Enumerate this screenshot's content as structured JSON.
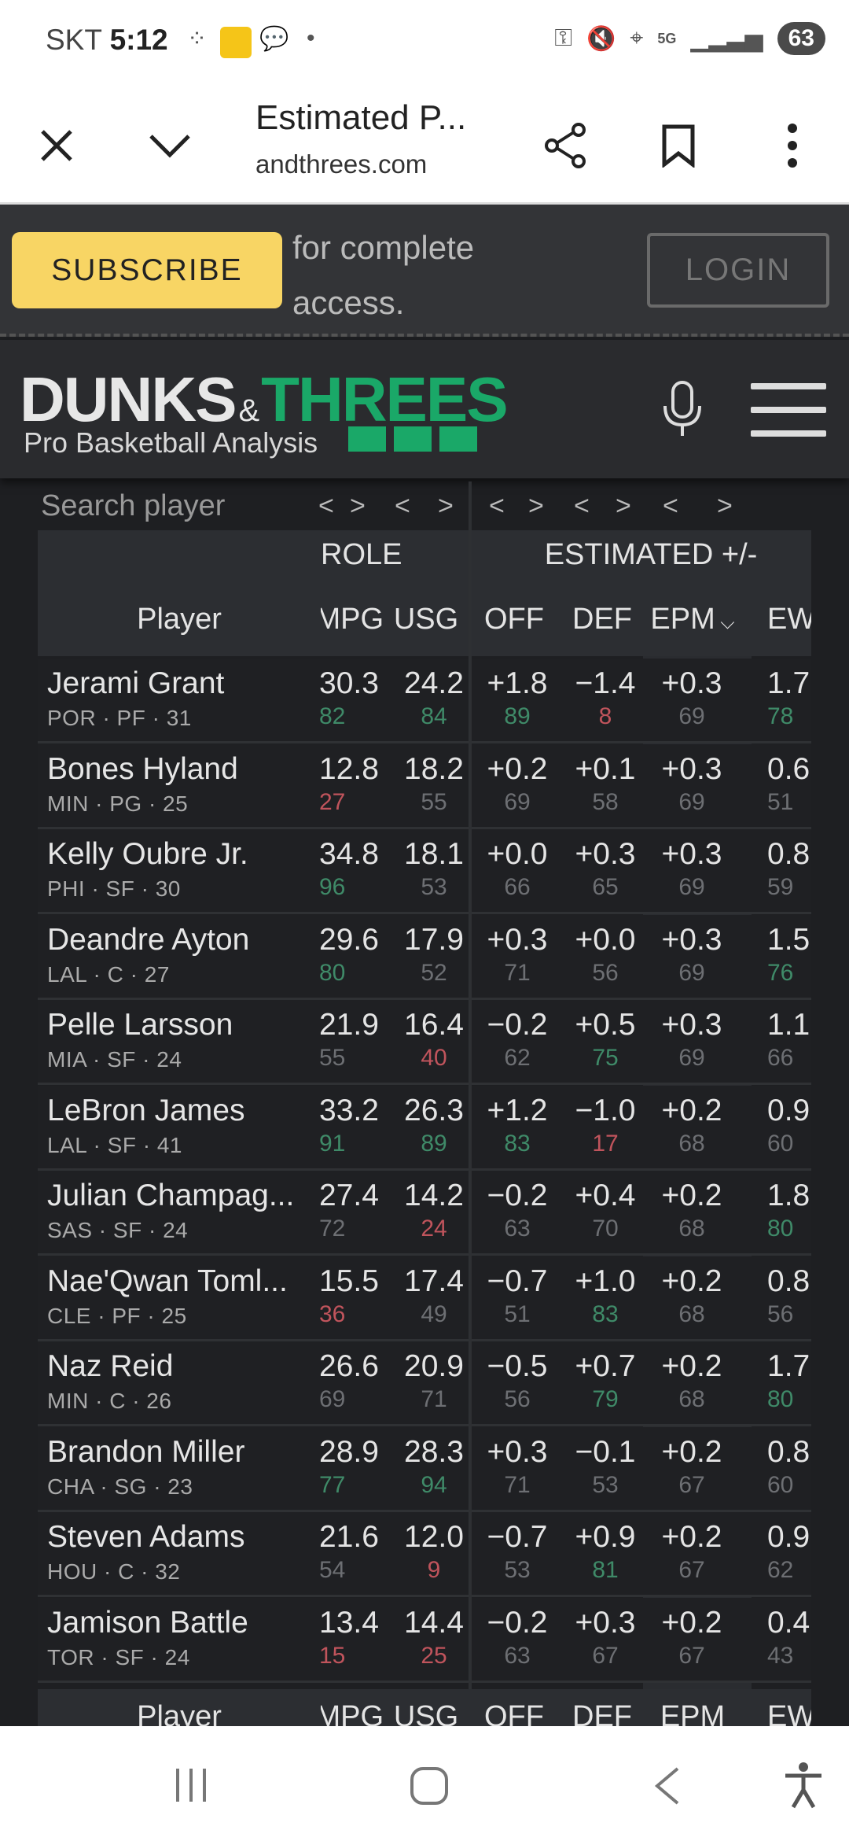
{
  "status": {
    "carrier": "SKT",
    "time": "5:12",
    "battery": "63"
  },
  "browser": {
    "title": "Estimated P...",
    "domain": "andthrees.com"
  },
  "banner": {
    "subscribe": "SUBSCRIBE",
    "text_line1": "for complete",
    "text_line2": "access.",
    "login": "LOGIN"
  },
  "logo": {
    "word1": "DUNKS",
    "amp": "&",
    "word2": "THREES",
    "tagline": "Pro Basketball Analysis"
  },
  "search": {
    "placeholder": "Search player"
  },
  "nav_arrows": [
    "<",
    ">",
    "<",
    ">",
    "<",
    ">",
    "<",
    ">",
    "<",
    ">"
  ],
  "groups": {
    "role": "ROLE",
    "estimated": "ESTIMATED +/-"
  },
  "columns": {
    "player": "Player",
    "mpg": "MPG",
    "usg": "USG",
    "off": "OFF",
    "def": "DEF",
    "epm": "EPM",
    "ew": "EW"
  },
  "colors": {
    "accent": "#1aa868",
    "subscribe": "#f8d564",
    "good": "#3f8a68",
    "bad": "#c0545c"
  },
  "rows": [
    {
      "name": "Jerami Grant",
      "meta": "POR · PF · 31",
      "mpg": "30.3",
      "mpg_p": "82",
      "usg": "24.2",
      "usg_p": "84",
      "off": "+1.8",
      "off_p": "89",
      "def": "−1.4",
      "def_p": "8",
      "epm": "+0.3",
      "epm_p": "69",
      "ew": "1.7",
      "ew_p": "78"
    },
    {
      "name": "Bones Hyland",
      "meta": "MIN · PG · 25",
      "mpg": "12.8",
      "mpg_p": "27",
      "usg": "18.2",
      "usg_p": "55",
      "off": "+0.2",
      "off_p": "69",
      "def": "+0.1",
      "def_p": "58",
      "epm": "+0.3",
      "epm_p": "69",
      "ew": "0.6",
      "ew_p": "51"
    },
    {
      "name": "Kelly Oubre Jr.",
      "meta": "PHI · SF · 30",
      "mpg": "34.8",
      "mpg_p": "96",
      "usg": "18.1",
      "usg_p": "53",
      "off": "+0.0",
      "off_p": "66",
      "def": "+0.3",
      "def_p": "65",
      "epm": "+0.3",
      "epm_p": "69",
      "ew": "0.8",
      "ew_p": "59"
    },
    {
      "name": "Deandre Ayton",
      "meta": "LAL · C · 27",
      "mpg": "29.6",
      "mpg_p": "80",
      "usg": "17.9",
      "usg_p": "52",
      "off": "+0.3",
      "off_p": "71",
      "def": "+0.0",
      "def_p": "56",
      "epm": "+0.3",
      "epm_p": "69",
      "ew": "1.5",
      "ew_p": "76"
    },
    {
      "name": "Pelle Larsson",
      "meta": "MIA · SF · 24",
      "mpg": "21.9",
      "mpg_p": "55",
      "usg": "16.4",
      "usg_p": "40",
      "off": "−0.2",
      "off_p": "62",
      "def": "+0.5",
      "def_p": "75",
      "epm": "+0.3",
      "epm_p": "69",
      "ew": "1.1",
      "ew_p": "66"
    },
    {
      "name": "LeBron James",
      "meta": "LAL · SF · 41",
      "mpg": "33.2",
      "mpg_p": "91",
      "usg": "26.3",
      "usg_p": "89",
      "off": "+1.2",
      "off_p": "83",
      "def": "−1.0",
      "def_p": "17",
      "epm": "+0.2",
      "epm_p": "68",
      "ew": "0.9",
      "ew_p": "60"
    },
    {
      "name": "Julian Champag...",
      "meta": "SAS · SF · 24",
      "mpg": "27.4",
      "mpg_p": "72",
      "usg": "14.2",
      "usg_p": "24",
      "off": "−0.2",
      "off_p": "63",
      "def": "+0.4",
      "def_p": "70",
      "epm": "+0.2",
      "epm_p": "68",
      "ew": "1.8",
      "ew_p": "80"
    },
    {
      "name": "Nae'Qwan Toml...",
      "meta": "CLE · PF · 25",
      "mpg": "15.5",
      "mpg_p": "36",
      "usg": "17.4",
      "usg_p": "49",
      "off": "−0.7",
      "off_p": "51",
      "def": "+1.0",
      "def_p": "83",
      "epm": "+0.2",
      "epm_p": "68",
      "ew": "0.8",
      "ew_p": "56"
    },
    {
      "name": "Naz Reid",
      "meta": "MIN · C · 26",
      "mpg": "26.6",
      "mpg_p": "69",
      "usg": "20.9",
      "usg_p": "71",
      "off": "−0.5",
      "off_p": "56",
      "def": "+0.7",
      "def_p": "79",
      "epm": "+0.2",
      "epm_p": "68",
      "ew": "1.7",
      "ew_p": "80"
    },
    {
      "name": "Brandon Miller",
      "meta": "CHA · SG · 23",
      "mpg": "28.9",
      "mpg_p": "77",
      "usg": "28.3",
      "usg_p": "94",
      "off": "+0.3",
      "off_p": "71",
      "def": "−0.1",
      "def_p": "53",
      "epm": "+0.2",
      "epm_p": "67",
      "ew": "0.8",
      "ew_p": "60"
    },
    {
      "name": "Steven Adams",
      "meta": "HOU · C · 32",
      "mpg": "21.6",
      "mpg_p": "54",
      "usg": "12.0",
      "usg_p": "9",
      "off": "−0.7",
      "off_p": "53",
      "def": "+0.9",
      "def_p": "81",
      "epm": "+0.2",
      "epm_p": "67",
      "ew": "0.9",
      "ew_p": "62"
    },
    {
      "name": "Jamison Battle",
      "meta": "TOR · SF · 24",
      "mpg": "13.4",
      "mpg_p": "15",
      "usg": "14.4",
      "usg_p": "25",
      "off": "−0.2",
      "off_p": "63",
      "def": "+0.3",
      "def_p": "67",
      "epm": "+0.2",
      "epm_p": "67",
      "ew": "0.4",
      "ew_p": "43"
    }
  ]
}
